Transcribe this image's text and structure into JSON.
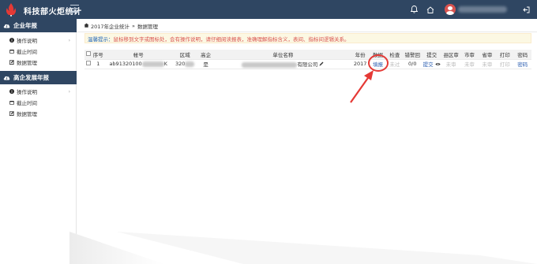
{
  "header": {
    "app_title": "科技部火炬统计",
    "icons": [
      "bell-icon",
      "home-icon",
      "user-avatar",
      "logout-icon"
    ]
  },
  "sidebar": {
    "sections": [
      {
        "title": "企业年报",
        "icon": "cloud-upload-icon",
        "items": [
          {
            "label": "操作说明",
            "icon": "info-icon"
          },
          {
            "label": "截止时间",
            "icon": "calendar-icon"
          },
          {
            "label": "数据管理",
            "icon": "edit-icon"
          }
        ]
      },
      {
        "title": "高企发展年报",
        "icon": "cloud-upload-icon",
        "items": [
          {
            "label": "操作说明",
            "icon": "info-icon"
          },
          {
            "label": "截止时间",
            "icon": "calendar-icon"
          },
          {
            "label": "数据管理",
            "icon": "edit-icon"
          }
        ]
      }
    ]
  },
  "breadcrumb": {
    "home": "2017年企业统计",
    "separator": "»",
    "current": "数据管理"
  },
  "notice": {
    "label": "温馨提示：",
    "text": "鼠标移到文字或图标处，会有操作说明，请仔细阅读报表，准确理解指标含义，表间、指标间逻辑关系。"
  },
  "table": {
    "columns": [
      "序号",
      "帐号",
      "区域",
      "高企",
      "单位名称",
      "年份",
      "数据",
      "检查",
      "错警回",
      "提交",
      "县区审",
      "市审",
      "省审",
      "打印",
      "密码"
    ],
    "rows": [
      {
        "index": "1",
        "account_prefix": "ab91320100",
        "account_suffix": "K",
        "region_prefix": "320",
        "high_tech": "是",
        "unit_suffix": "有限公司",
        "year": "2017",
        "data": "填报",
        "check": "未过",
        "error_return": "0/0",
        "submit": "提交",
        "county_review": "未审",
        "city_review": "未审",
        "province_review": "未审",
        "print": "打印",
        "password": "密码"
      }
    ]
  },
  "colors": {
    "topbar": "#2f4662",
    "link": "#2a5db0",
    "notice_bg": "#fcf8e3",
    "highlight": "#e53935"
  }
}
